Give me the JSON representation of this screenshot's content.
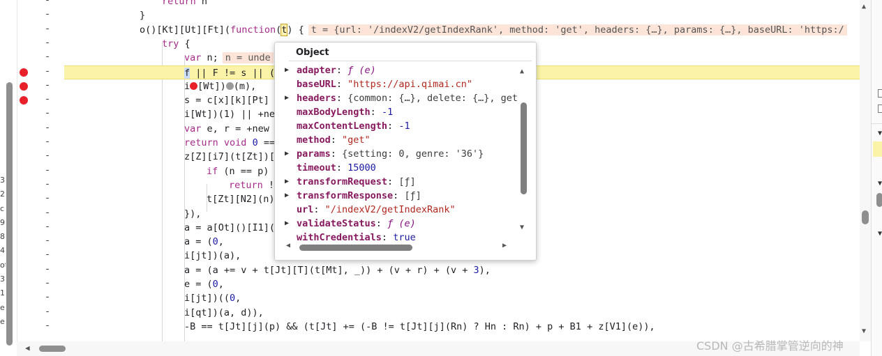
{
  "editor": {
    "gutter_dash": "-",
    "lines": [
      {
        "segments": [
          {
            "t": "return",
            "c": "kw"
          },
          {
            "t": " n"
          }
        ]
      },
      {
        "segments": [
          {
            "t": "}"
          }
        ]
      },
      {
        "segments": [
          {
            "t": "o()[Kt][Ut][Ft]("
          },
          {
            "t": "function",
            "c": "kw"
          },
          {
            "t": "("
          },
          {
            "t": "t",
            "c": "cursor"
          },
          {
            "t": ") {"
          },
          {
            "t": "t = {url: '/indexV2/getIndexRank', method: 'get', headers: {…}, params: {…}, baseURL: 'https:/",
            "c": "inline"
          }
        ]
      },
      {
        "segments": [
          {
            "t": "try",
            "c": "kw"
          },
          {
            "t": " {"
          }
        ]
      },
      {
        "segments": [
          {
            "t": "var",
            "c": "kw"
          },
          {
            "t": " n;"
          },
          {
            "t": "n = unde",
            "c": "inline"
          }
        ]
      },
      {
        "segments": [
          {
            "t": "f",
            "c": "sel"
          },
          {
            "t": " || F != s || ("
          }
        ]
      },
      {
        "segments": [
          {
            "t": "i"
          },
          {
            "t": "",
            "c": "rbp"
          },
          {
            "t": "[Wt])"
          },
          {
            "t": "",
            "c": "gbp"
          },
          {
            "t": "(m),"
          }
        ]
      },
      {
        "segments": [
          {
            "t": "s = c[x][k][Pt]"
          }
        ]
      },
      {
        "segments": [
          {
            "t": "i[Wt])(1) || +ne"
          }
        ]
      },
      {
        "segments": [
          {
            "t": "var",
            "c": "kw"
          },
          {
            "t": " e, r = +new"
          }
        ]
      },
      {
        "segments": [
          {
            "t": "return",
            "c": "kw"
          },
          {
            "t": " "
          },
          {
            "t": "void",
            "c": "kw"
          },
          {
            "t": " "
          },
          {
            "t": "0",
            "c": "num"
          },
          {
            "t": " =="
          }
        ]
      },
      {
        "segments": [
          {
            "t": "z[Z][i7](t[Zt])["
          }
        ]
      },
      {
        "segments": [
          {
            "t": "if",
            "c": "kw"
          },
          {
            "t": " (n == p)"
          }
        ]
      },
      {
        "segments": [
          {
            "t": "return",
            "c": "kw"
          },
          {
            "t": " !"
          }
        ]
      },
      {
        "segments": [
          {
            "t": "t[Zt][N2](n)"
          }
        ]
      },
      {
        "segments": [
          {
            "t": "}),"
          }
        ]
      },
      {
        "segments": [
          {
            "t": "a = a[Ot]()[I1]("
          }
        ]
      },
      {
        "segments": [
          {
            "t": "a = ("
          },
          {
            "t": "0",
            "c": "num"
          },
          {
            "t": ","
          }
        ]
      },
      {
        "segments": [
          {
            "t": "i[jt])(a),"
          }
        ]
      },
      {
        "segments": [
          {
            "t": "a = (a += v + t[Jt][T](t[Mt], _)) + (v + r) + (v + "
          },
          {
            "t": "3",
            "c": "num"
          },
          {
            "t": "),"
          }
        ]
      },
      {
        "segments": [
          {
            "t": "e = ("
          },
          {
            "t": "0",
            "c": "num"
          },
          {
            "t": ","
          }
        ]
      },
      {
        "segments": [
          {
            "t": "i[jt])(("
          },
          {
            "t": "0",
            "c": "num"
          },
          {
            "t": ","
          }
        ]
      },
      {
        "segments": [
          {
            "t": "i[qt])(a, d)),"
          }
        ]
      },
      {
        "segments": [
          {
            "t": "-B == t[Jt][j](p) && (t[Jt] += (-B != t[Jt][j](Rn) ? Hn : Rn) + p + B1 + z[V1](e)),"
          }
        ]
      }
    ]
  },
  "left_strip_chars": [
    "3:",
    "2",
    "c",
    "9",
    "8",
    "4(",
    "ot",
    "3",
    "1",
    "e",
    "e"
  ],
  "popup": {
    "title": "Object",
    "props": [
      {
        "key": "adapter",
        "value": "ƒ (e)",
        "kind": "fn",
        "expandable": true
      },
      {
        "key": "baseURL",
        "value": "\"https://api.qimai.cn\"",
        "kind": "str",
        "expandable": false
      },
      {
        "key": "headers",
        "value": "{common: {…}, delete: {…}, get",
        "kind": "obj",
        "expandable": true
      },
      {
        "key": "maxBodyLength",
        "value": "-1",
        "kind": "num",
        "expandable": false
      },
      {
        "key": "maxContentLength",
        "value": "-1",
        "kind": "num",
        "expandable": false
      },
      {
        "key": "method",
        "value": "\"get\"",
        "kind": "str",
        "expandable": false
      },
      {
        "key": "params",
        "value": "{setting: 0, genre: '36'}",
        "kind": "obj",
        "expandable": true
      },
      {
        "key": "timeout",
        "value": "15000",
        "kind": "num",
        "expandable": false
      },
      {
        "key": "transformRequest",
        "value": "[ƒ]",
        "kind": "obj",
        "expandable": true
      },
      {
        "key": "transformResponse",
        "value": "[ƒ]",
        "kind": "obj",
        "expandable": true
      },
      {
        "key": "url",
        "value": "\"/indexV2/getIndexRank\"",
        "kind": "str",
        "expandable": false
      },
      {
        "key": "validateStatus",
        "value": "ƒ (e)",
        "kind": "fn",
        "expandable": true
      },
      {
        "key": "withCredentials",
        "value": "true",
        "kind": "bool",
        "expandable": false
      }
    ]
  },
  "watermark": "CSDN @古希腊掌管逆向的神",
  "icons": {
    "expand": "▶",
    "scroll_up": "▲",
    "scroll_down": "▼",
    "scroll_left": "◀",
    "scroll_right": "▶"
  },
  "colors": {
    "breakpoint": "#e8202a",
    "current_line": "#fbf4a8",
    "inline_value_bg": "#fde4d9",
    "keyword": "#a52a8a"
  }
}
